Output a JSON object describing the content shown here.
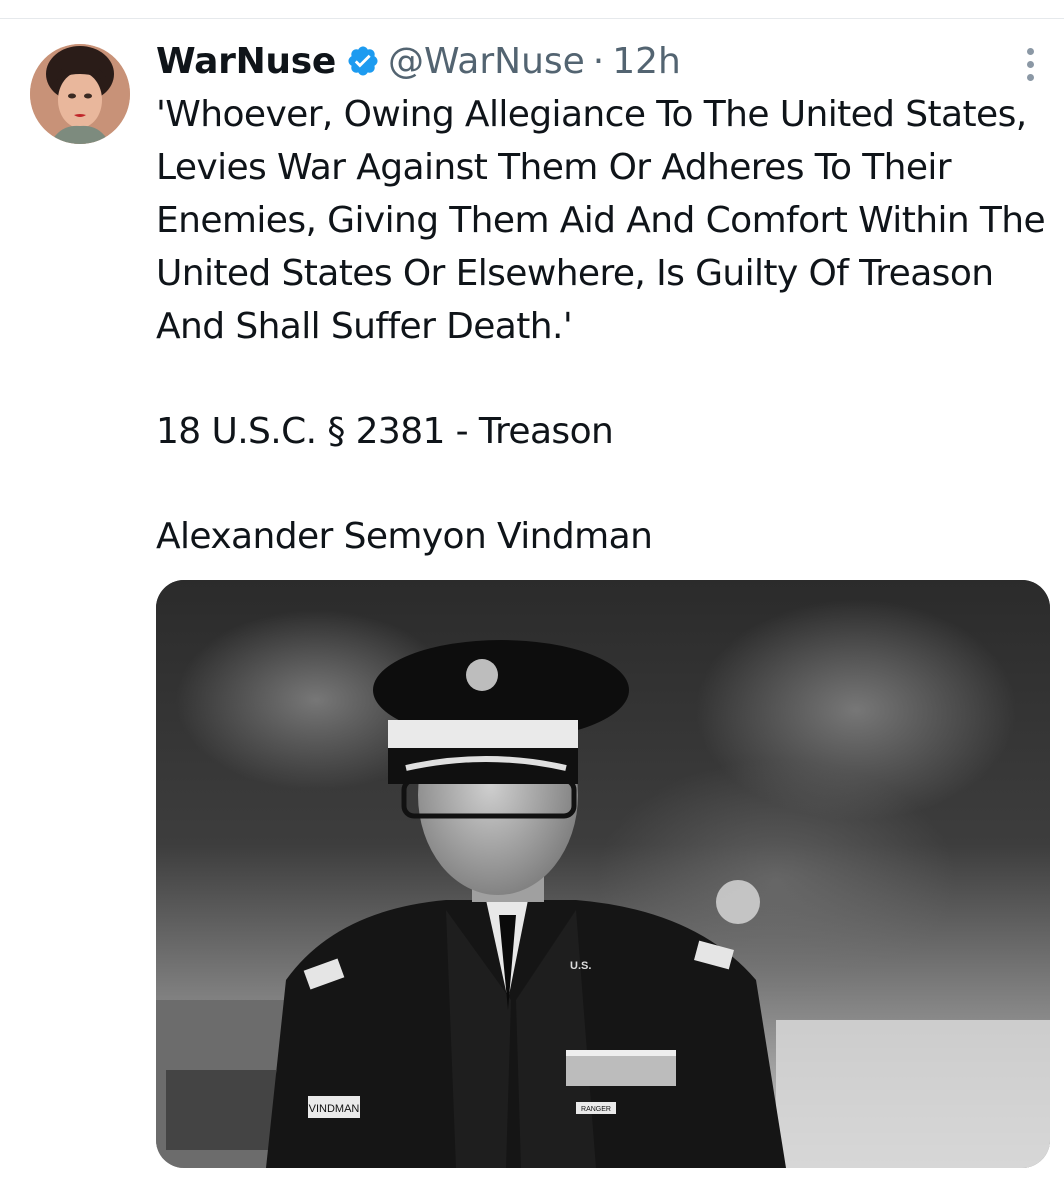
{
  "tweet": {
    "author": {
      "display_name": "WarNuse",
      "handle": "@WarNuse",
      "verified": true
    },
    "separator": "·",
    "timestamp": "12h",
    "paragraphs": [
      "'Whoever, Owing Allegiance To The United States, Levies War Against Them Or Adheres To Their Enemies, Giving Them Aid And Comfort Within The United States Or Elsewhere, Is Guilty Of Treason And Shall Suffer Death.'",
      "18 U.S.C. § 2381 - Treason",
      "Alexander Semyon Vindman"
    ],
    "media": {
      "name_tape": "VINDMAN",
      "collar_insignia": "U.S.",
      "tab": "RANGER"
    }
  },
  "colors": {
    "text_primary": "#0f1419",
    "text_secondary": "#536471",
    "verified_blue": "#1d9bf0",
    "divider": "#e6e9ec"
  },
  "icons": {
    "verified": "verified-badge-icon",
    "more": "more-vertical-icon"
  }
}
